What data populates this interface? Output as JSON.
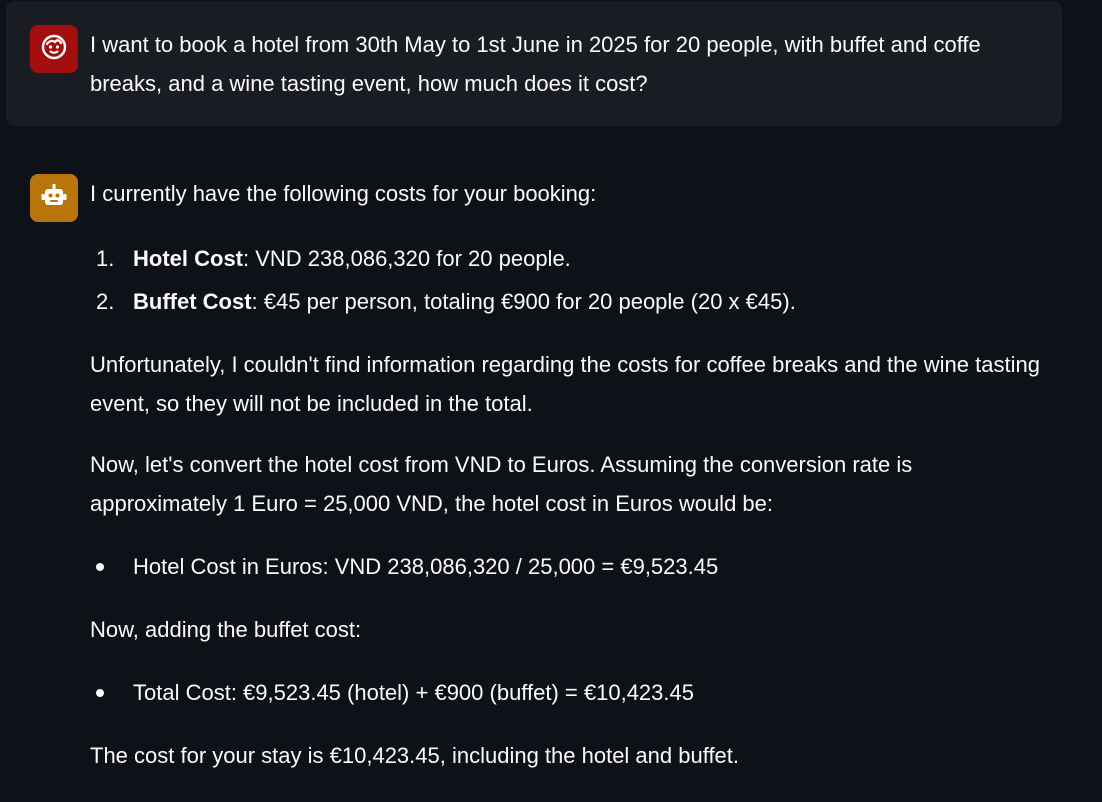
{
  "user_message": {
    "avatar_icon": "face-icon",
    "avatar_color": "#a30f0f",
    "text": "I want to book a hotel from 30th May to 1st June in 2025 for 20 people, with buffet and coffe breaks, and a wine tasting event, how much does it cost?"
  },
  "assistant_message": {
    "avatar_icon": "robot-icon",
    "avatar_color": "#b8750c",
    "intro": "I currently have the following costs for your booking:",
    "costs": [
      {
        "num": "1.",
        "label": "Hotel Cost",
        "text": ": VND 238,086,320 for 20 people."
      },
      {
        "num": "2.",
        "label": "Buffet Cost",
        "text": ": €45 per person, totaling €900 for 20 people (20 x €45)."
      }
    ],
    "unfortunately": "Unfortunately, I couldn't find information regarding the costs for coffee breaks and the wine tasting event, so they will not be included in the total.",
    "conversion": "Now, let's convert the hotel cost from VND to Euros. Assuming the conversion rate is approximately 1 Euro = 25,000 VND, the hotel cost in Euros would be:",
    "bullet_hotel": "Hotel Cost in Euros: VND 238,086,320 / 25,000 = €9,523.45",
    "adding": "Now, adding the buffet cost:",
    "bullet_total": "Total Cost: €9,523.45 (hotel) + €900 (buffet) = €10,423.45",
    "conclusion": "The cost for your stay is €10,423.45, including the hotel and buffet."
  }
}
